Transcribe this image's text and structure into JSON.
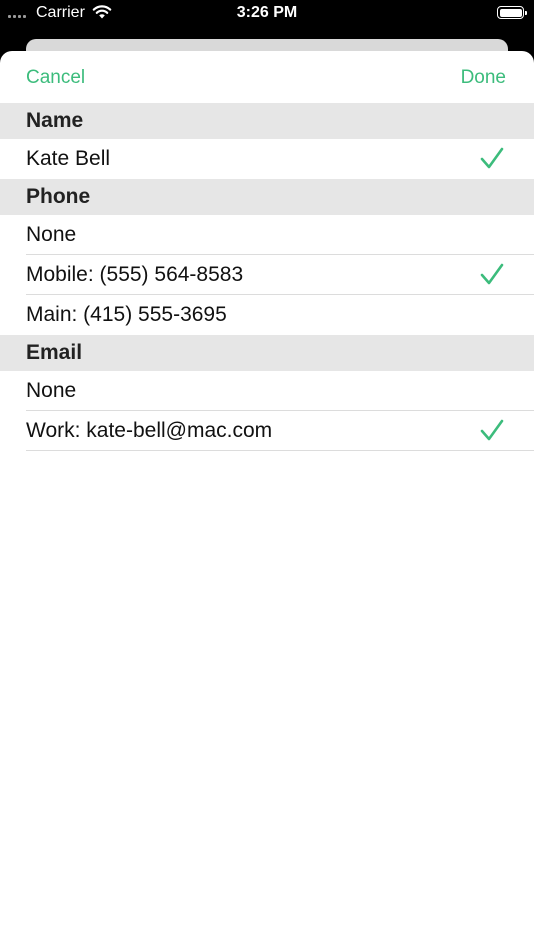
{
  "status_bar": {
    "carrier": "Carrier",
    "time": "3:26 PM"
  },
  "nav": {
    "cancel_label": "Cancel",
    "done_label": "Done"
  },
  "colors": {
    "accent": "#3cbc7c",
    "section_header_bg": "#e6e6e6"
  },
  "sections": {
    "name": {
      "header": "Name",
      "rows": [
        {
          "label": "Kate Bell",
          "checked": true
        }
      ]
    },
    "phone": {
      "header": "Phone",
      "rows": [
        {
          "label": "None",
          "checked": false
        },
        {
          "label": "Mobile: (555) 564-8583",
          "checked": true
        },
        {
          "label": "Main: (415) 555-3695",
          "checked": false
        }
      ]
    },
    "email": {
      "header": "Email",
      "rows": [
        {
          "label": "None",
          "checked": false
        },
        {
          "label": "Work: kate-bell@mac.com",
          "checked": true
        }
      ]
    }
  },
  "icons": [
    "signal-icon",
    "wifi-icon",
    "battery-icon",
    "checkmark-icon"
  ]
}
